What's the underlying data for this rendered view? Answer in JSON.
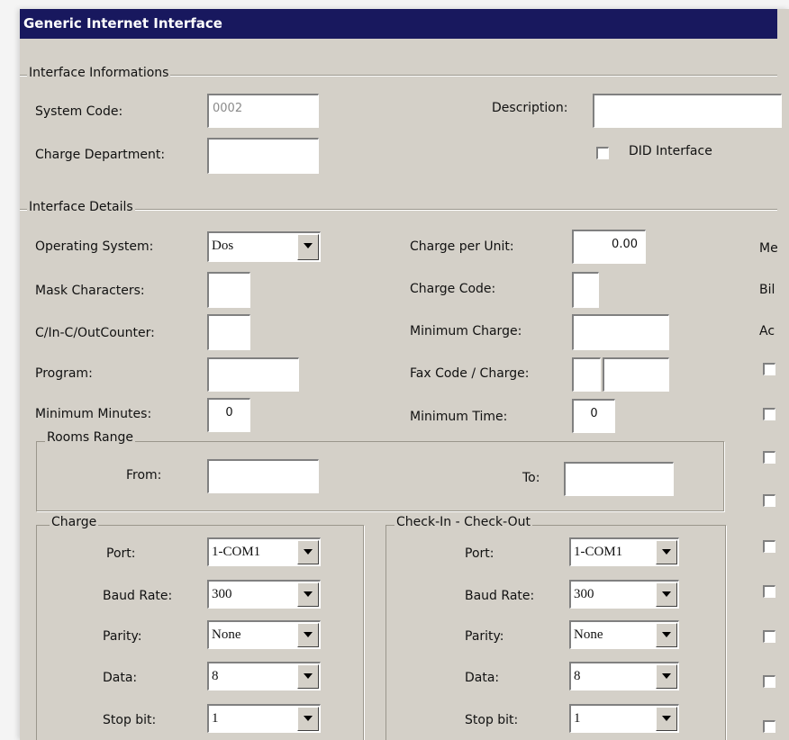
{
  "window": {
    "title": "Generic Internet Interface"
  },
  "info": {
    "legend": "Interface Informations",
    "system_code_label": "System Code:",
    "system_code_value": "0002",
    "description_label": "Description:",
    "description_value": "",
    "charge_dept_label": "Charge Department:",
    "charge_dept_value": "",
    "did_label": "DID Interface"
  },
  "details": {
    "legend": "Interface Details",
    "os_label": "Operating System:",
    "os_value": "Dos",
    "mask_label": "Mask Characters:",
    "counter_label": "C/In-C/OutCounter:",
    "program_label": "Program:",
    "min_minutes_label": "Minimum Minutes:",
    "min_minutes_value": "0",
    "charge_per_unit_label": "Charge per Unit:",
    "charge_per_unit_value": "0.00",
    "charge_code_label": "Charge Code:",
    "min_charge_label": "Minimum Charge:",
    "fax_label": "Fax Code / Charge:",
    "min_time_label": "Minimum Time:",
    "min_time_value": "0",
    "cut_label_1": "Me",
    "cut_label_2": "Bil",
    "cut_label_3": "Ac"
  },
  "rooms": {
    "legend": "Rooms Range",
    "from_label": "From:",
    "to_label": "To:"
  },
  "charge": {
    "legend": "Charge",
    "port_label": "Port:",
    "port_value": "1-COM1",
    "baud_label": "Baud Rate:",
    "baud_value": "300",
    "parity_label": "Parity:",
    "parity_value": "None",
    "data_label": "Data:",
    "data_value": "8",
    "stop_label": "Stop bit:",
    "stop_value": "1"
  },
  "checkin": {
    "legend": "Check-In - Check-Out",
    "port_label": "Port:",
    "port_value": "1-COM1",
    "baud_label": "Baud Rate:",
    "baud_value": "300",
    "parity_label": "Parity:",
    "parity_value": "None",
    "data_label": "Data:",
    "data_value": "8",
    "stop_label": "Stop bit:",
    "stop_value": "1"
  }
}
